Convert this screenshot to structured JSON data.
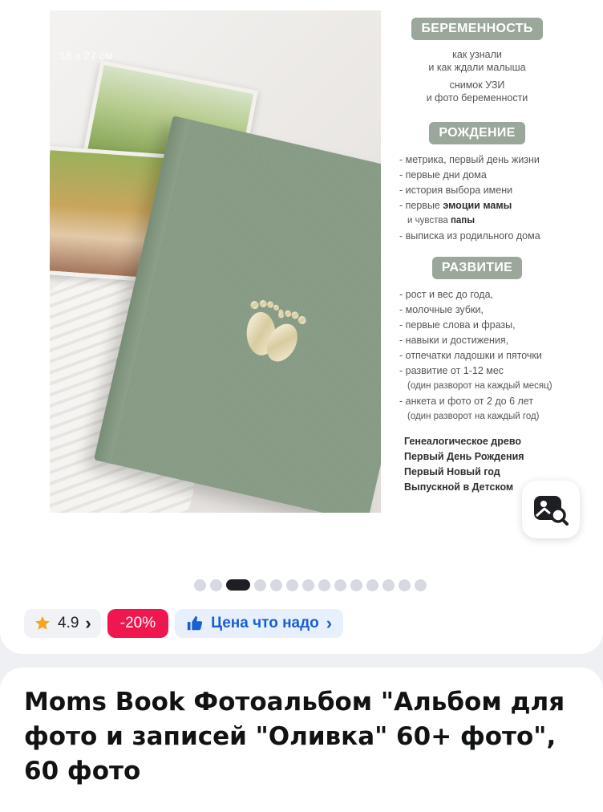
{
  "gallery": {
    "size_label": "18 x 27 см",
    "sections": [
      {
        "heading": "БЕРЕМЕННОСТЬ",
        "lines": [
          "как узнали",
          "и как ждали малыша",
          "снимок УЗИ",
          "и фото беременности"
        ]
      },
      {
        "heading": "РОЖДЕНИЕ",
        "items": [
          "- метрика, первый день жизни",
          "- первые дни дома",
          "- история выбора имени"
        ],
        "emotions_prefix": "- первые ",
        "emotions_bold": "эмоции мамы",
        "feelings_prefix": "и чувства ",
        "feelings_bold": "папы",
        "last_item": "- выписка из родильного дома"
      },
      {
        "heading": "РАЗВИТИЕ",
        "items": [
          "- рост и вес до года,",
          "- молочные зубки,",
          "- первые слова и фразы,",
          "- навыки и достижения,",
          "- отпечатки ладошки и пяточки",
          "- развитие от 1-12 мес",
          "(один разворот на каждый месяц)",
          "- анкета и фото от 2 до 6 лет",
          "(один разворот на каждый год)"
        ]
      }
    ],
    "extras": [
      "Генеалогическое древо",
      "Первый День Рождения",
      "Первый Новый год",
      "Выпускной в Детском"
    ],
    "pager": {
      "total": 14,
      "active_index": 2
    }
  },
  "lens_button": {
    "icon": "image-search-icon"
  },
  "chips": {
    "rating": "4.9",
    "rating_arrow": "›",
    "discount": "-20%",
    "price_label": "Цена что надо",
    "price_arrow": "›"
  },
  "product": {
    "title": "Moms Book Фотоальбом \"Альбом для фото и записей \"Оливка\" 60+ фото\", 60 фото"
  },
  "colors": {
    "discount": "#f0164e",
    "price_chip_text": "#1a5fd0",
    "star": "#f7a61b",
    "section_pill": "#9aa79a"
  }
}
